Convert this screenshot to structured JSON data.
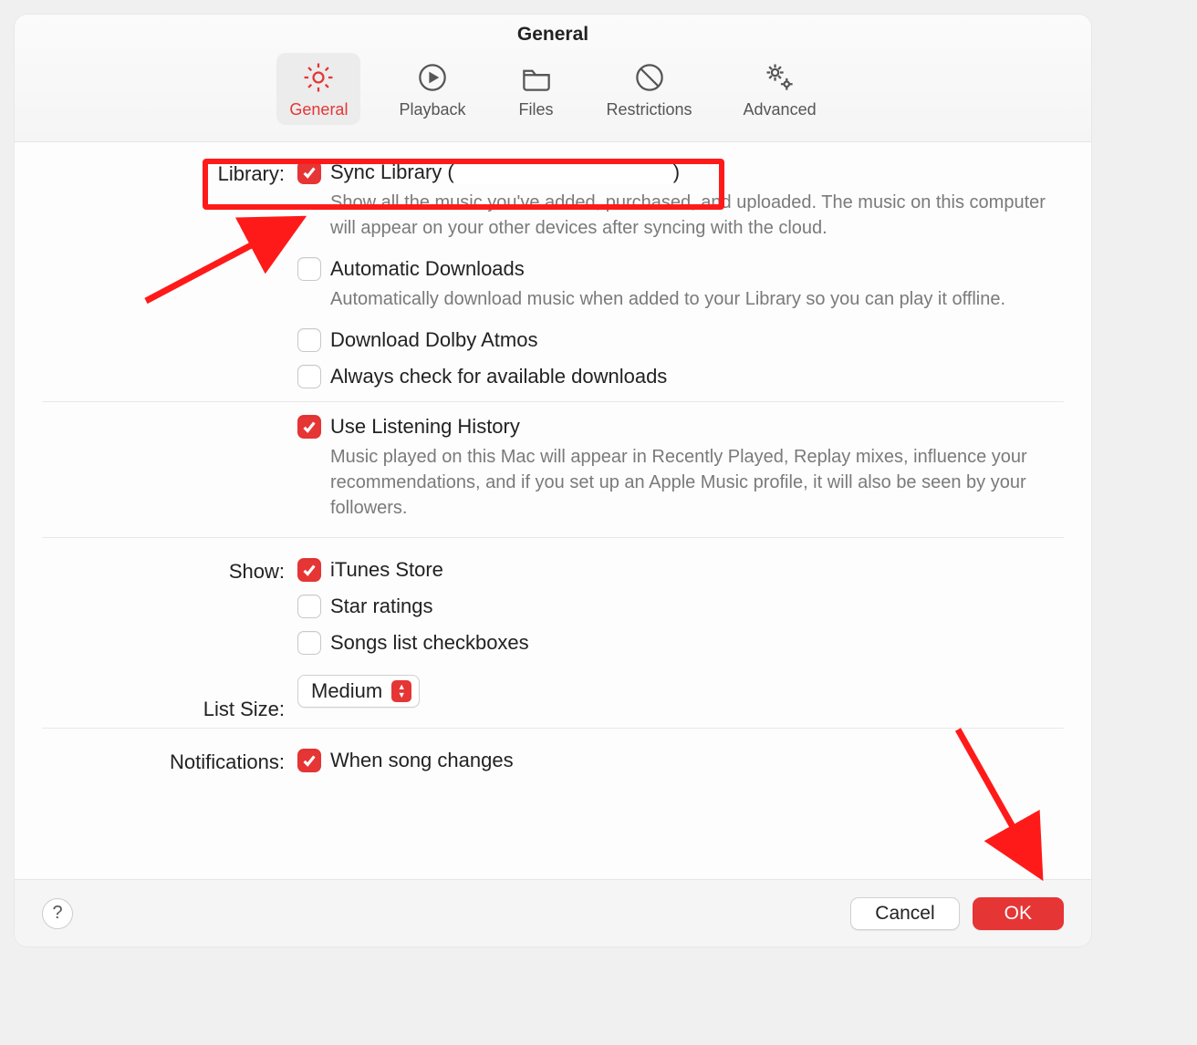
{
  "window": {
    "title": "General"
  },
  "tabs": [
    {
      "id": "general",
      "label": "General",
      "active": true,
      "icon": "gear-icon"
    },
    {
      "id": "playback",
      "label": "Playback",
      "active": false,
      "icon": "play-icon"
    },
    {
      "id": "files",
      "label": "Files",
      "active": false,
      "icon": "folder-icon"
    },
    {
      "id": "restrictions",
      "label": "Restrictions",
      "active": false,
      "icon": "prohibit-icon"
    },
    {
      "id": "advanced",
      "label": "Advanced",
      "active": false,
      "icon": "gears-icon"
    }
  ],
  "sections": {
    "library": {
      "label": "Library:",
      "sync": {
        "checked": true,
        "label_prefix": "Sync Library (",
        "label_suffix": ")",
        "account_redacted": true,
        "desc": "Show all the music you've added, purchased, and uploaded. The music on this computer will appear on your other devices after syncing with the cloud."
      },
      "auto_downloads": {
        "checked": false,
        "label": "Automatic Downloads",
        "desc": "Automatically download music when added to your Library so you can play it offline."
      },
      "dolby": {
        "checked": false,
        "label": "Download Dolby Atmos"
      },
      "check_downloads": {
        "checked": false,
        "label": "Always check for available downloads"
      },
      "listening_history": {
        "checked": true,
        "label": "Use Listening History",
        "desc": "Music played on this Mac will appear in Recently Played, Replay mixes, influence your recommendations, and if you set up an Apple Music profile, it will also be seen by your followers."
      }
    },
    "show": {
      "label": "Show:",
      "itunes_store": {
        "checked": true,
        "label": "iTunes Store"
      },
      "star_ratings": {
        "checked": false,
        "label": "Star ratings"
      },
      "songs_checkboxes": {
        "checked": false,
        "label": "Songs list checkboxes"
      }
    },
    "list_size": {
      "label": "List Size:",
      "value": "Medium"
    },
    "notifications": {
      "label": "Notifications:",
      "song_changes": {
        "checked": true,
        "label": "When song changes"
      }
    }
  },
  "footer": {
    "help": "?",
    "cancel": "Cancel",
    "ok": "OK"
  },
  "colors": {
    "accent": "#e63535",
    "annotation": "#ff1a1a"
  }
}
